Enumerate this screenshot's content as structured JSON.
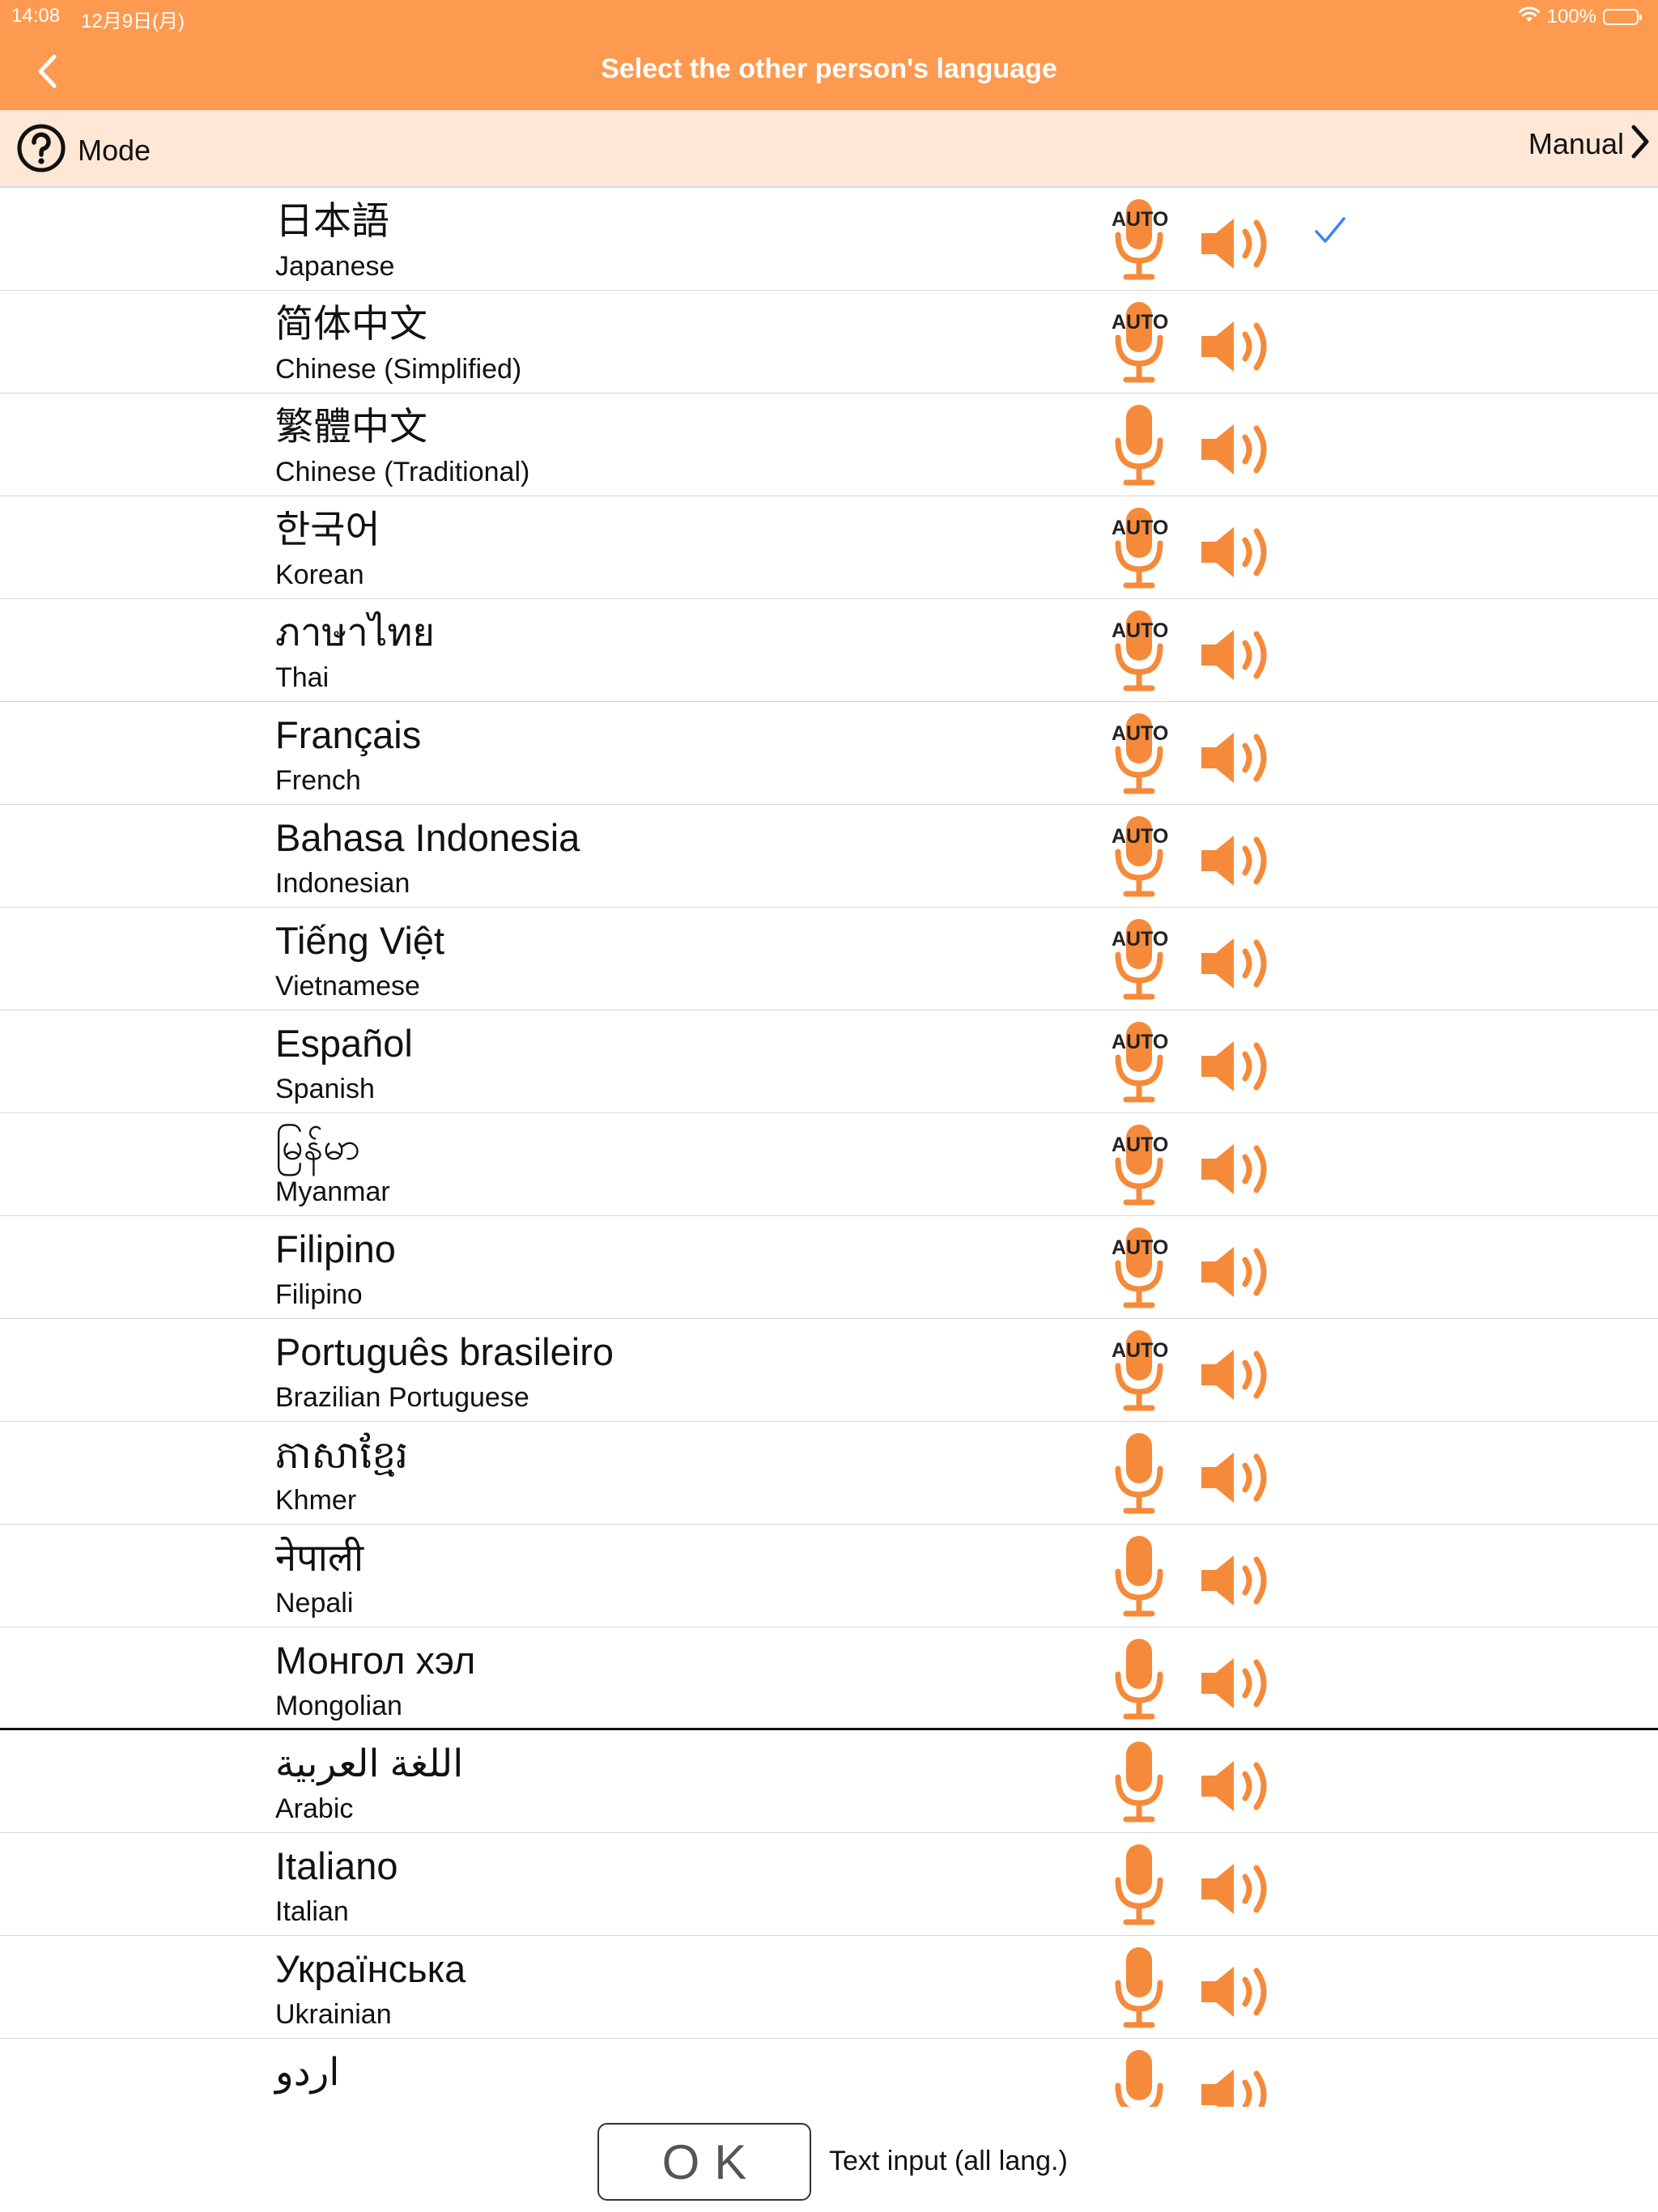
{
  "status_bar": {
    "time": "14:08",
    "date": "12月9日(月)",
    "battery": "100%",
    "battery_level": 1.0
  },
  "nav": {
    "title": "Select the other person's language",
    "back_icon": "chevron-left-icon"
  },
  "mode_bar": {
    "label": "Mode",
    "help_icon": "question-circle-icon",
    "value": "Manual",
    "chevron_icon": "chevron-right-icon"
  },
  "colors": {
    "accent": "#fd9a50",
    "mode_bar_bg": "#ffe7d6",
    "check": "#3b82f6"
  },
  "auto_badge": "AUTO",
  "languages": [
    {
      "native": "日本語",
      "english": "Japanese",
      "auto": true,
      "selected": true
    },
    {
      "native": "简体中文",
      "english": "Chinese (Simplified)",
      "auto": true,
      "selected": false
    },
    {
      "native": "繁體中文",
      "english": "Chinese (Traditional)",
      "auto": false,
      "selected": false
    },
    {
      "native": "한국어",
      "english": "Korean",
      "auto": true,
      "selected": false
    },
    {
      "native": "ภาษาไทย",
      "english": "Thai",
      "auto": true,
      "selected": false
    },
    {
      "native": "Français",
      "english": "French",
      "auto": true,
      "selected": false
    },
    {
      "native": "Bahasa Indonesia",
      "english": "Indonesian",
      "auto": true,
      "selected": false
    },
    {
      "native": "Tiếng Việt",
      "english": "Vietnamese",
      "auto": true,
      "selected": false
    },
    {
      "native": "Español",
      "english": "Spanish",
      "auto": true,
      "selected": false
    },
    {
      "native": "မြန်မာ",
      "english": "Myanmar",
      "auto": true,
      "selected": false
    },
    {
      "native": "Filipino",
      "english": "Filipino",
      "auto": true,
      "selected": false
    },
    {
      "native": "Português brasileiro",
      "english": "Brazilian Portuguese",
      "auto": true,
      "selected": false
    },
    {
      "native": "ភាសាខ្មែរ",
      "english": "Khmer",
      "auto": false,
      "selected": false
    },
    {
      "native": "नेपाली",
      "english": "Nepali",
      "auto": false,
      "selected": false
    },
    {
      "native": "Монгол хэл",
      "english": "Mongolian",
      "auto": false,
      "selected": false
    },
    {
      "native": "اللغة العربية",
      "english": "Arabic",
      "auto": false,
      "selected": false
    },
    {
      "native": "Italiano",
      "english": "Italian",
      "auto": false,
      "selected": false
    },
    {
      "native": "Українська",
      "english": "Ukrainian",
      "auto": false,
      "selected": false
    },
    {
      "native": "اردو",
      "english": "",
      "auto": false,
      "selected": false
    }
  ],
  "bottom": {
    "ok_label": "OK",
    "text_input_label": "Text input (all lang.)"
  }
}
